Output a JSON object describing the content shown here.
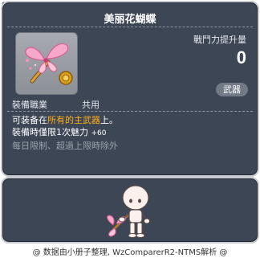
{
  "item_id": "01702174",
  "title": "美丽花蝴蝶",
  "score": {
    "label": "戰鬥力提升量",
    "value": "0"
  },
  "type_badge": "武器",
  "job": {
    "label": "裝備職業",
    "value": "共用"
  },
  "description": {
    "line1_prefix": "可装备在",
    "line1_highlight": "所有的主武器",
    "line1_suffix": "上。",
    "line2": "裝備時僅限1次魅力",
    "line2_value": "+60",
    "line3": "每日限制、超過上限時除外"
  },
  "footer": "@ 数据由小册子整理, WzComparerR2-NTMS解析 @",
  "icons": {
    "item": "butterfly-weapon-icon",
    "character": "character-preview"
  }
}
